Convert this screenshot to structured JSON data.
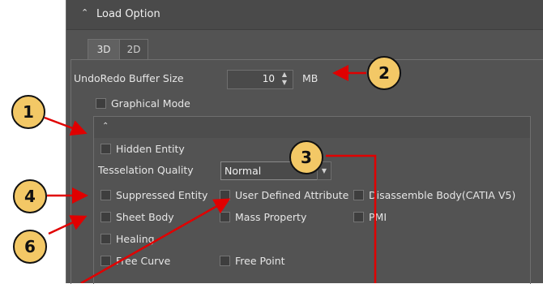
{
  "section": {
    "title": "Load Option",
    "chevron": "chevron-up-icon"
  },
  "tabs": [
    {
      "label": "3D",
      "active": true
    },
    {
      "label": "2D",
      "active": false
    }
  ],
  "buffer": {
    "label": "UndoRedo Buffer Size",
    "value": "10",
    "unit": "MB"
  },
  "options": {
    "graphical_mode": "Graphical Mode",
    "hidden_entity": "Hidden Entity",
    "tesselation_label": "Tesselation Quality",
    "tesselation_value": "Normal",
    "suppressed_entity": "Suppressed Entity",
    "user_defined_attribute": "User Defined Attribute",
    "disassemble_body": "Disassemble Body(CATIA V5)",
    "sheet_body": "Sheet Body",
    "mass_property": "Mass Property",
    "pmi": "PMI",
    "healing": "Healing",
    "free_curve": "Free Curve",
    "free_point": "Free Point"
  },
  "callouts": {
    "c1": "1",
    "c2": "2",
    "c3": "3",
    "c4": "4",
    "c6": "6"
  },
  "colors": {
    "panel": "#535353",
    "callout_fill": "#f3c866",
    "arrow": "#e00000"
  }
}
